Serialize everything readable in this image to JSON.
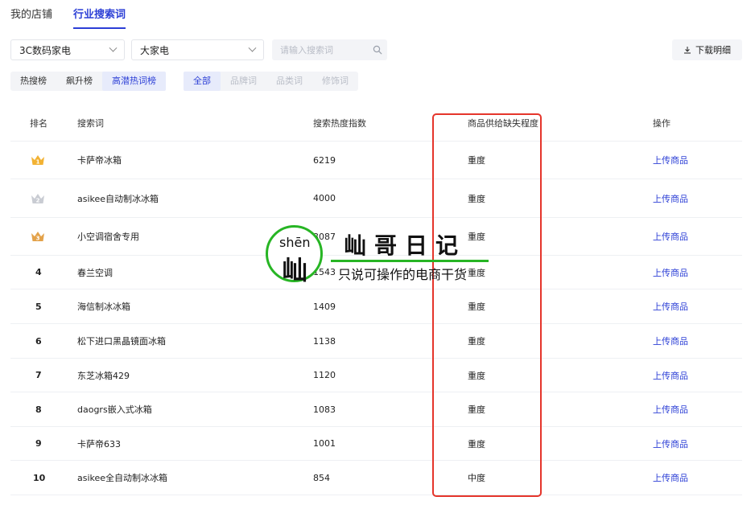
{
  "top_tabs": [
    {
      "label": "我的店铺",
      "active": false
    },
    {
      "label": "行业搜索词",
      "active": true
    }
  ],
  "filters": {
    "category": "3C数码家电",
    "subcategory": "大家电",
    "search_placeholder": "请输入搜索词",
    "download_label": "下载明细"
  },
  "rank_tabs": [
    {
      "label": "热搜榜",
      "active": false
    },
    {
      "label": "飙升榜",
      "active": false
    },
    {
      "label": "高潜热词榜",
      "active": true
    }
  ],
  "word_types": [
    {
      "label": "全部",
      "state": "active"
    },
    {
      "label": "品牌词",
      "state": "disabled"
    },
    {
      "label": "品类词",
      "state": "disabled"
    },
    {
      "label": "修饰词",
      "state": "disabled"
    }
  ],
  "table": {
    "headers": {
      "rank": "排名",
      "word": "搜索词",
      "heat": "搜索热度指数",
      "degree": "商品供给缺失程度",
      "action": "操作"
    },
    "rows": [
      {
        "rank": "1",
        "word": "卡萨帝冰箱",
        "heat": "6219",
        "degree": "重度",
        "action": "上传商品"
      },
      {
        "rank": "2",
        "word": "asikee自动制冰冰箱",
        "heat": "4000",
        "degree": "重度",
        "action": "上传商品"
      },
      {
        "rank": "3",
        "word": "小空调宿舍专用",
        "heat": "3087",
        "degree": "重度",
        "action": "上传商品"
      },
      {
        "rank": "4",
        "word": "春兰空调",
        "heat": "1543",
        "degree": "重度",
        "action": "上传商品"
      },
      {
        "rank": "5",
        "word": "海信制冰冰箱",
        "heat": "1409",
        "degree": "重度",
        "action": "上传商品"
      },
      {
        "rank": "6",
        "word": "松下进口黑晶镜面冰箱",
        "heat": "1138",
        "degree": "重度",
        "action": "上传商品"
      },
      {
        "rank": "7",
        "word": "东芝冰箱429",
        "heat": "1120",
        "degree": "重度",
        "action": "上传商品"
      },
      {
        "rank": "8",
        "word": "daogrs嵌入式冰箱",
        "heat": "1083",
        "degree": "重度",
        "action": "上传商品"
      },
      {
        "rank": "9",
        "word": "卡萨帝633",
        "heat": "1001",
        "degree": "重度",
        "action": "上传商品"
      },
      {
        "rank": "10",
        "word": "asikee全自动制冰冰箱",
        "heat": "854",
        "degree": "中度",
        "action": "上传商品"
      }
    ]
  },
  "watermark": {
    "pinyin": "shēn",
    "char": "屾",
    "title": "屾哥日记",
    "subtitle": "只说可操作的电商干货"
  },
  "colors": {
    "accent": "#2c3fd6",
    "highlight": "#e5352b",
    "watermark_green": "#27b524",
    "gold": "#f2b233",
    "silver": "#c9ccd3",
    "bronze": "#e3a24a"
  }
}
